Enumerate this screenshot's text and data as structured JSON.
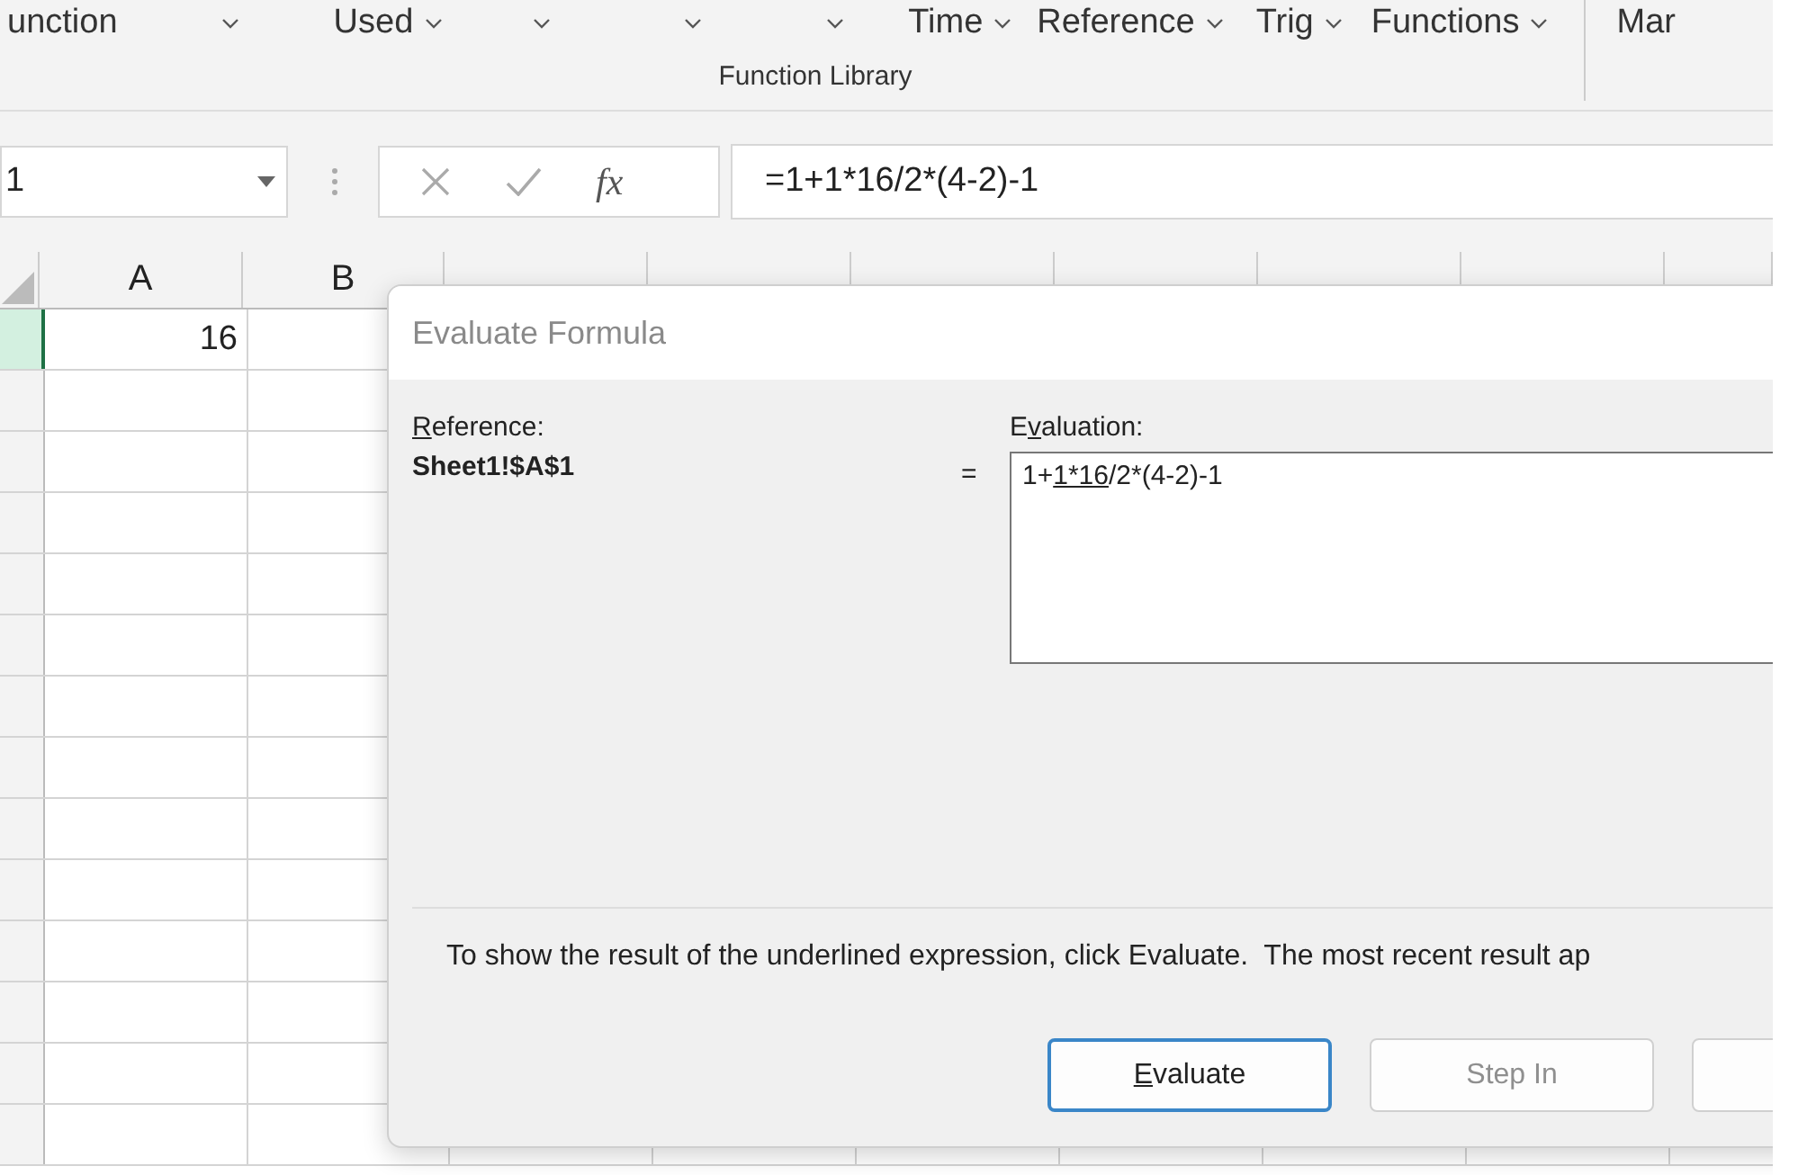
{
  "ribbon": {
    "items": [
      {
        "kind": "text",
        "label": "unction"
      },
      {
        "kind": "chevron"
      },
      {
        "kind": "menu",
        "label": "Used"
      },
      {
        "kind": "chevron"
      },
      {
        "kind": "chevron"
      },
      {
        "kind": "chevron"
      },
      {
        "kind": "menu",
        "label": "Time"
      },
      {
        "kind": "menu",
        "label": "Reference"
      },
      {
        "kind": "menu",
        "label": "Trig"
      },
      {
        "kind": "menu",
        "label": "Functions"
      },
      {
        "kind": "divider"
      },
      {
        "kind": "text",
        "label": "Mar"
      }
    ],
    "group_label": "Function Library"
  },
  "formula_bar": {
    "name_box": "1",
    "function_button": "fx",
    "formula": "=1+1*16/2*(4-2)-1"
  },
  "sheet": {
    "columns": [
      {
        "label": "A"
      },
      {
        "label": "B"
      },
      {},
      {},
      {},
      {},
      {},
      {},
      {}
    ],
    "rows": [
      {
        "selected": true,
        "cells": [
          "16"
        ]
      },
      {
        "selected": false
      },
      {
        "selected": false
      },
      {
        "selected": false
      },
      {
        "selected": false
      },
      {
        "selected": false
      },
      {
        "selected": false
      },
      {
        "selected": false
      },
      {
        "selected": false
      },
      {
        "selected": false
      },
      {
        "selected": false
      },
      {
        "selected": false
      },
      {
        "selected": false
      },
      {
        "selected": false
      }
    ]
  },
  "dialog": {
    "title": "Evaluate Formula",
    "reference_label": {
      "underlined": "R",
      "after": "eference:"
    },
    "reference": "Sheet1!$A$1",
    "equals": "=",
    "evaluation_label": {
      "before": "E",
      "underlined": "v",
      "after": "aluation:"
    },
    "evaluation": {
      "before": "1+",
      "underlined": "1*16",
      "after": "/2*(4-2)-1"
    },
    "message": "To show the result of the underlined expression, click Evaluate.  The most recent result ap",
    "buttons": [
      {
        "label": {
          "underlined": "E",
          "after": "valuate"
        },
        "default": true,
        "disabled": false
      },
      {
        "label": {
          "before": "Step In"
        },
        "disabled": true,
        "default": false
      },
      {
        "default": false
      }
    ]
  }
}
